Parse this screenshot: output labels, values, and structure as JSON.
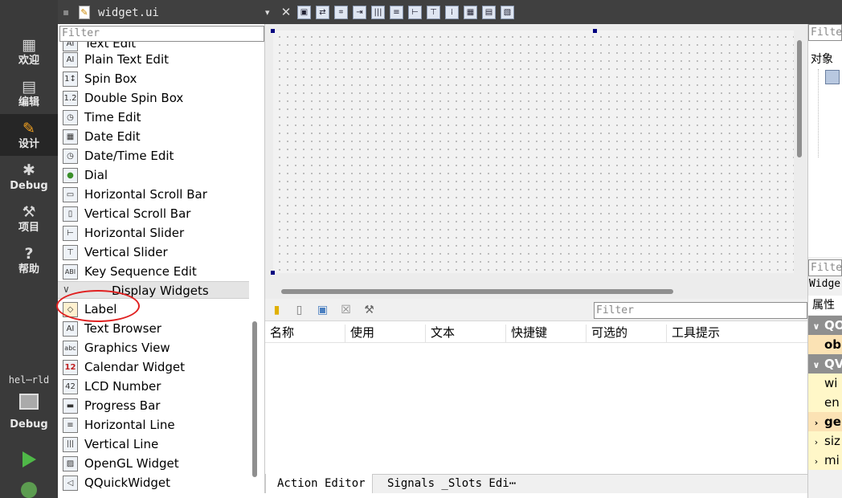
{
  "modebar": {
    "modes": [
      {
        "label": "欢迎",
        "icon": "grid-icon"
      },
      {
        "label": "编辑",
        "icon": "document-icon"
      },
      {
        "label": "设计",
        "icon": "pencil-icon"
      },
      {
        "label": "Debug",
        "icon": "bug-icon"
      },
      {
        "label": "项目",
        "icon": "wrench-icon"
      },
      {
        "label": "帮助",
        "icon": "help-icon"
      }
    ],
    "target": "hel⋯rld",
    "target_mode": "Debug"
  },
  "filebar": {
    "filename": "widget.ui",
    "dropdown_glyph": "▾",
    "close_glyph": "✕"
  },
  "widgetbox": {
    "filter_placeholder": "Filter",
    "items": [
      {
        "label": "Text Edit",
        "icon": "AI"
      },
      {
        "label": "Plain Text Edit",
        "icon": "AI"
      },
      {
        "label": "Spin Box",
        "icon": "1↕"
      },
      {
        "label": "Double Spin Box",
        "icon": "1.2"
      },
      {
        "label": "Time Edit",
        "icon": "◷"
      },
      {
        "label": "Date Edit",
        "icon": "▦"
      },
      {
        "label": "Date/Time Edit",
        "icon": "◷"
      },
      {
        "label": "Dial",
        "icon": "●"
      },
      {
        "label": "Horizontal Scroll Bar",
        "icon": "▭"
      },
      {
        "label": "Vertical Scroll Bar",
        "icon": "▯"
      },
      {
        "label": "Horizontal Slider",
        "icon": "⊢"
      },
      {
        "label": "Vertical Slider",
        "icon": "⊤"
      },
      {
        "label": "Key Sequence Edit",
        "icon": "ABI"
      }
    ],
    "category": "Display Widgets",
    "display_items": [
      {
        "label": "Label",
        "icon": "◇"
      },
      {
        "label": "Text Browser",
        "icon": "AI"
      },
      {
        "label": "Graphics View",
        "icon": "abc"
      },
      {
        "label": "Calendar Widget",
        "icon": "12"
      },
      {
        "label": "LCD Number",
        "icon": "42"
      },
      {
        "label": "Progress Bar",
        "icon": "▬"
      },
      {
        "label": "Horizontal Line",
        "icon": "≡"
      },
      {
        "label": "Vertical Line",
        "icon": "|||"
      },
      {
        "label": "OpenGL Widget",
        "icon": "▨"
      },
      {
        "label": "QQuickWidget",
        "icon": "◁"
      }
    ]
  },
  "action_editor": {
    "filter_placeholder": "Filter",
    "columns": [
      "名称",
      "使用",
      "文本",
      "快捷键",
      "可选的",
      "工具提示"
    ]
  },
  "bottom_tabs": [
    "Action Editor",
    "Signals _Slots Edi⋯"
  ],
  "object_inspector": {
    "filter_placeholder": "Filte",
    "header": "对象"
  },
  "property_editor": {
    "filter_placeholder": "Filte",
    "widget_label": "Widge",
    "header": "属性",
    "rows": [
      {
        "text": "QO",
        "kind": "grp",
        "arrow": "∨"
      },
      {
        "text": "ob",
        "kind": "obj",
        "arrow": ""
      },
      {
        "text": "QV",
        "kind": "grp",
        "arrow": "∨"
      },
      {
        "text": "wi",
        "kind": "val",
        "arrow": ""
      },
      {
        "text": "en",
        "kind": "val",
        "arrow": ""
      },
      {
        "text": "ge",
        "kind": "obj",
        "arrow": "›"
      },
      {
        "text": "siz",
        "kind": "val",
        "arrow": "›"
      },
      {
        "text": "mi",
        "kind": "val",
        "arrow": "›"
      }
    ]
  },
  "colors": {
    "modebar_bg": "#3a3a3a",
    "group_header": "#8f8f8f",
    "object_row": "#fbe2b4",
    "value_row": "#fff7c8",
    "selection_handle": "#000080",
    "highlight_ring": "#e02020"
  }
}
